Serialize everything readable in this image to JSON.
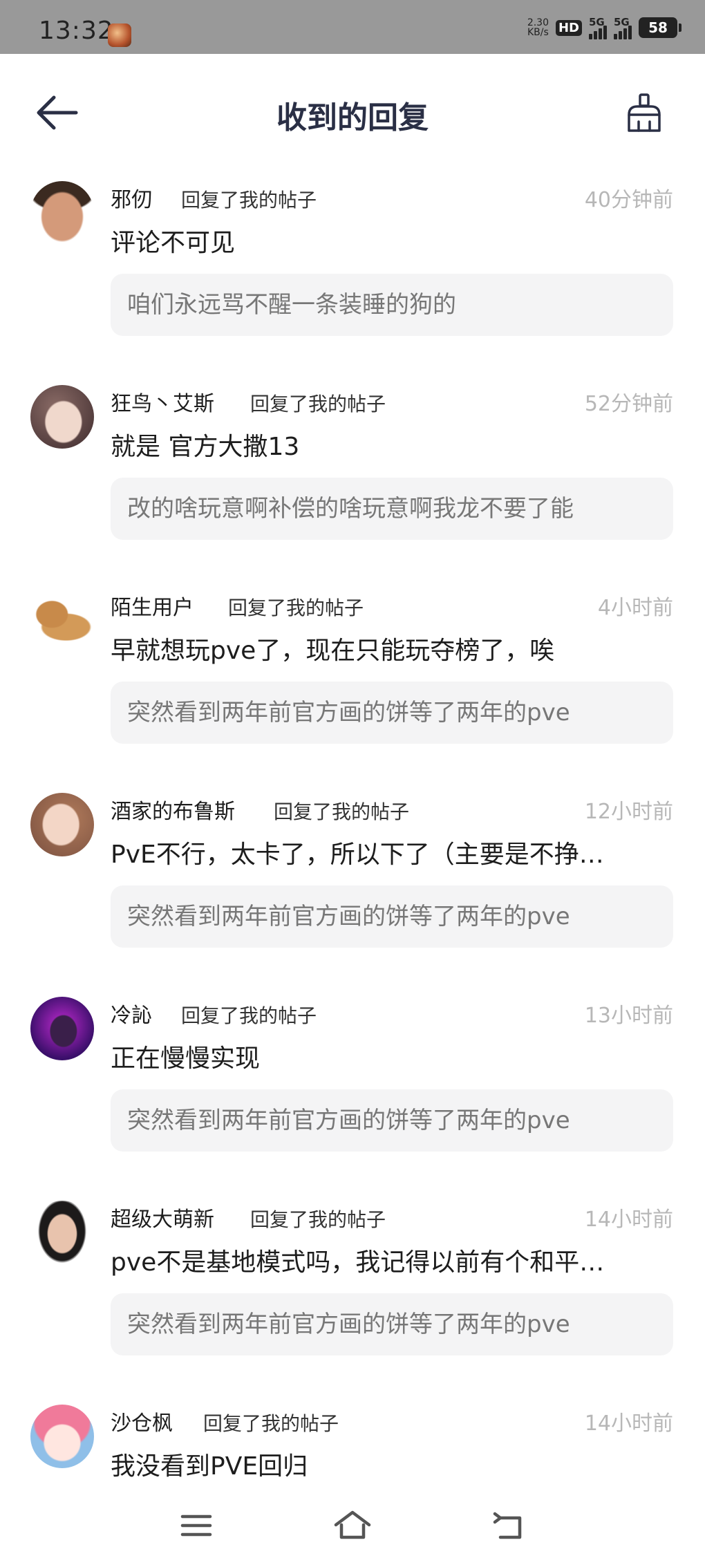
{
  "status_bar": {
    "time": "13:32",
    "net_speed_value": "2.30",
    "net_speed_unit": "KB/s",
    "hd": "HD",
    "sim1_label": "5G",
    "sim2_label": "5G",
    "battery": "58"
  },
  "header": {
    "title": "收到的回复",
    "back_icon": "arrow-left-icon",
    "clear_icon": "broom-icon"
  },
  "replies": [
    {
      "username": "邪仞",
      "action": "回复了我的帖子",
      "time": "40分钟前",
      "comment": "评论不可见",
      "quote": "咱们永远骂不醒一条装睡的狗的",
      "avatar": "avatar-man"
    },
    {
      "username": "狂鸟丶艾斯",
      "action": "回复了我的帖子",
      "time": "52分钟前",
      "comment": "就是 官方大撒13",
      "quote": "改的啥玩意啊补偿的啥玩意啊我龙不要了能",
      "avatar": "avatar-anime"
    },
    {
      "username": "陌生用户",
      "action": "回复了我的帖子",
      "time": "4小时前",
      "comment": "早就想玩pve了，现在只能玩夺榜了，唉",
      "quote": "突然看到两年前官方画的饼等了两年的pve",
      "avatar": "avatar-dog"
    },
    {
      "username": "酒家的布鲁斯",
      "action": "回复了我的帖子",
      "time": "12小时前",
      "comment": "PvE不行，太卡了，所以下了（主要是不挣…",
      "quote": "突然看到两年前官方画的饼等了两年的pve",
      "avatar": "avatar-woman"
    },
    {
      "username": "冷訫",
      "action": "回复了我的帖子",
      "time": "13小时前",
      "comment": "正在慢慢实现",
      "quote": "突然看到两年前官方画的饼等了两年的pve",
      "avatar": "avatar-ninja"
    },
    {
      "username": "超级大萌新",
      "action": "回复了我的帖子",
      "time": "14小时前",
      "comment": "pve不是基地模式吗，我记得以前有个和平…",
      "quote": "突然看到两年前官方画的饼等了两年的pve",
      "avatar": "avatar-girl"
    },
    {
      "username": "沙仓枫",
      "action": "回复了我的帖子",
      "time": "14小时前",
      "comment": "我没看到PVE回归",
      "quote": "",
      "avatar": "avatar-pink-hair"
    }
  ],
  "nav_bar": {
    "menu_icon": "menu-icon",
    "home_icon": "home-icon",
    "back_icon": "back-icon"
  },
  "colors": {
    "title": "#2a2f45",
    "timestamp": "#b7b7b7",
    "quote_bg": "#f4f4f5",
    "quote_text": "#777777",
    "status_bar_bg": "#999999"
  }
}
